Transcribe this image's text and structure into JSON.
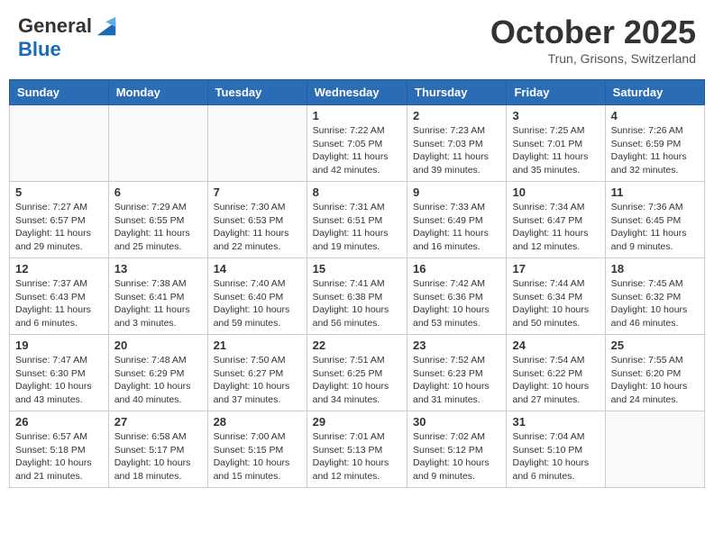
{
  "header": {
    "logo_line1": "General",
    "logo_line2": "Blue",
    "month_title": "October 2025",
    "location": "Trun, Grisons, Switzerland"
  },
  "weekdays": [
    "Sunday",
    "Monday",
    "Tuesday",
    "Wednesday",
    "Thursday",
    "Friday",
    "Saturday"
  ],
  "weeks": [
    [
      {
        "day": "",
        "info": ""
      },
      {
        "day": "",
        "info": ""
      },
      {
        "day": "",
        "info": ""
      },
      {
        "day": "1",
        "info": "Sunrise: 7:22 AM\nSunset: 7:05 PM\nDaylight: 11 hours and 42 minutes."
      },
      {
        "day": "2",
        "info": "Sunrise: 7:23 AM\nSunset: 7:03 PM\nDaylight: 11 hours and 39 minutes."
      },
      {
        "day": "3",
        "info": "Sunrise: 7:25 AM\nSunset: 7:01 PM\nDaylight: 11 hours and 35 minutes."
      },
      {
        "day": "4",
        "info": "Sunrise: 7:26 AM\nSunset: 6:59 PM\nDaylight: 11 hours and 32 minutes."
      }
    ],
    [
      {
        "day": "5",
        "info": "Sunrise: 7:27 AM\nSunset: 6:57 PM\nDaylight: 11 hours and 29 minutes."
      },
      {
        "day": "6",
        "info": "Sunrise: 7:29 AM\nSunset: 6:55 PM\nDaylight: 11 hours and 25 minutes."
      },
      {
        "day": "7",
        "info": "Sunrise: 7:30 AM\nSunset: 6:53 PM\nDaylight: 11 hours and 22 minutes."
      },
      {
        "day": "8",
        "info": "Sunrise: 7:31 AM\nSunset: 6:51 PM\nDaylight: 11 hours and 19 minutes."
      },
      {
        "day": "9",
        "info": "Sunrise: 7:33 AM\nSunset: 6:49 PM\nDaylight: 11 hours and 16 minutes."
      },
      {
        "day": "10",
        "info": "Sunrise: 7:34 AM\nSunset: 6:47 PM\nDaylight: 11 hours and 12 minutes."
      },
      {
        "day": "11",
        "info": "Sunrise: 7:36 AM\nSunset: 6:45 PM\nDaylight: 11 hours and 9 minutes."
      }
    ],
    [
      {
        "day": "12",
        "info": "Sunrise: 7:37 AM\nSunset: 6:43 PM\nDaylight: 11 hours and 6 minutes."
      },
      {
        "day": "13",
        "info": "Sunrise: 7:38 AM\nSunset: 6:41 PM\nDaylight: 11 hours and 3 minutes."
      },
      {
        "day": "14",
        "info": "Sunrise: 7:40 AM\nSunset: 6:40 PM\nDaylight: 10 hours and 59 minutes."
      },
      {
        "day": "15",
        "info": "Sunrise: 7:41 AM\nSunset: 6:38 PM\nDaylight: 10 hours and 56 minutes."
      },
      {
        "day": "16",
        "info": "Sunrise: 7:42 AM\nSunset: 6:36 PM\nDaylight: 10 hours and 53 minutes."
      },
      {
        "day": "17",
        "info": "Sunrise: 7:44 AM\nSunset: 6:34 PM\nDaylight: 10 hours and 50 minutes."
      },
      {
        "day": "18",
        "info": "Sunrise: 7:45 AM\nSunset: 6:32 PM\nDaylight: 10 hours and 46 minutes."
      }
    ],
    [
      {
        "day": "19",
        "info": "Sunrise: 7:47 AM\nSunset: 6:30 PM\nDaylight: 10 hours and 43 minutes."
      },
      {
        "day": "20",
        "info": "Sunrise: 7:48 AM\nSunset: 6:29 PM\nDaylight: 10 hours and 40 minutes."
      },
      {
        "day": "21",
        "info": "Sunrise: 7:50 AM\nSunset: 6:27 PM\nDaylight: 10 hours and 37 minutes."
      },
      {
        "day": "22",
        "info": "Sunrise: 7:51 AM\nSunset: 6:25 PM\nDaylight: 10 hours and 34 minutes."
      },
      {
        "day": "23",
        "info": "Sunrise: 7:52 AM\nSunset: 6:23 PM\nDaylight: 10 hours and 31 minutes."
      },
      {
        "day": "24",
        "info": "Sunrise: 7:54 AM\nSunset: 6:22 PM\nDaylight: 10 hours and 27 minutes."
      },
      {
        "day": "25",
        "info": "Sunrise: 7:55 AM\nSunset: 6:20 PM\nDaylight: 10 hours and 24 minutes."
      }
    ],
    [
      {
        "day": "26",
        "info": "Sunrise: 6:57 AM\nSunset: 5:18 PM\nDaylight: 10 hours and 21 minutes."
      },
      {
        "day": "27",
        "info": "Sunrise: 6:58 AM\nSunset: 5:17 PM\nDaylight: 10 hours and 18 minutes."
      },
      {
        "day": "28",
        "info": "Sunrise: 7:00 AM\nSunset: 5:15 PM\nDaylight: 10 hours and 15 minutes."
      },
      {
        "day": "29",
        "info": "Sunrise: 7:01 AM\nSunset: 5:13 PM\nDaylight: 10 hours and 12 minutes."
      },
      {
        "day": "30",
        "info": "Sunrise: 7:02 AM\nSunset: 5:12 PM\nDaylight: 10 hours and 9 minutes."
      },
      {
        "day": "31",
        "info": "Sunrise: 7:04 AM\nSunset: 5:10 PM\nDaylight: 10 hours and 6 minutes."
      },
      {
        "day": "",
        "info": ""
      }
    ]
  ]
}
